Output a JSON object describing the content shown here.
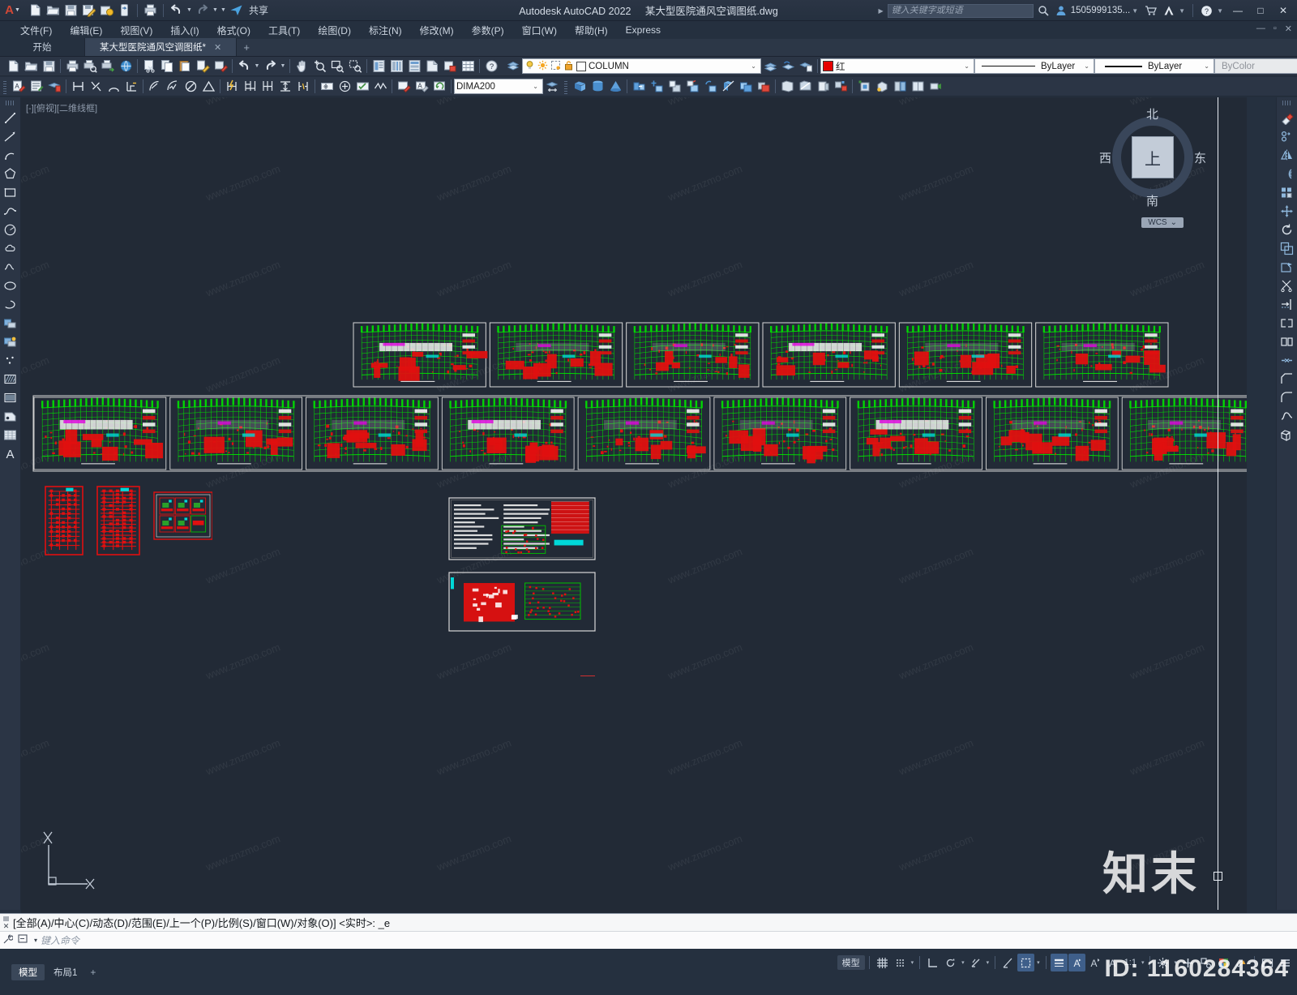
{
  "window": {
    "app_title": "Autodesk AutoCAD 2022",
    "file_name": "某大型医院通风空调图纸.dwg",
    "share_label": "共享",
    "search_placeholder": "键入关键字或短语",
    "user_account": "1505999135...",
    "minimize": "—",
    "maximize": "□",
    "close": "✕"
  },
  "menubar": {
    "items": [
      {
        "label": "文件(F)",
        "name": "menu-file"
      },
      {
        "label": "编辑(E)",
        "name": "menu-edit"
      },
      {
        "label": "视图(V)",
        "name": "menu-view"
      },
      {
        "label": "插入(I)",
        "name": "menu-insert"
      },
      {
        "label": "格式(O)",
        "name": "menu-format"
      },
      {
        "label": "工具(T)",
        "name": "menu-tools"
      },
      {
        "label": "绘图(D)",
        "name": "menu-draw"
      },
      {
        "label": "标注(N)",
        "name": "menu-dimension"
      },
      {
        "label": "修改(M)",
        "name": "menu-modify"
      },
      {
        "label": "参数(P)",
        "name": "menu-parametric"
      },
      {
        "label": "窗口(W)",
        "name": "menu-window"
      },
      {
        "label": "帮助(H)",
        "name": "menu-help"
      },
      {
        "label": "Express",
        "name": "menu-express"
      }
    ],
    "win_minimize": "—",
    "win_restore": "▫",
    "win_close": "✕"
  },
  "doctabs": {
    "start_label": "开始",
    "active_label": "某大型医院通风空调图纸*",
    "close_glyph": "✕",
    "new_tab_glyph": "+"
  },
  "properties": {
    "layer_name": "COLUMN",
    "color_name": "红",
    "color_hex": "#e60000",
    "linetype": "ByLayer",
    "lineweight": "ByLayer",
    "plotstyle": "ByColor",
    "dimstyle": "DIMA200",
    "dropdown_glyph": "⌄"
  },
  "viewport": {
    "label": "[-][俯视][二维线框]",
    "viewcube": {
      "north": "北",
      "south": "南",
      "west": "西",
      "east": "东",
      "top": "上",
      "wcs": "WCS",
      "wcs_caret": "⌄"
    },
    "ucs_x": "X",
    "ucs_y": "Y"
  },
  "left_toolbar": {
    "tools": [
      {
        "name": "line-icon",
        "title": "直线"
      },
      {
        "name": "polyline-icon",
        "title": "多段线"
      },
      {
        "name": "arc-icon",
        "title": "圆弧"
      },
      {
        "name": "polygon-icon",
        "title": "多边形"
      },
      {
        "name": "rectangle-icon",
        "title": "矩形"
      },
      {
        "name": "spline-icon",
        "title": "样条曲线"
      },
      {
        "name": "circle-icon",
        "title": "圆"
      },
      {
        "name": "revision-cloud-icon",
        "title": "修订云线"
      },
      {
        "name": "wave-line-icon",
        "title": "波浪线"
      },
      {
        "name": "ellipse-icon",
        "title": "椭圆"
      },
      {
        "name": "elliptical-arc-icon",
        "title": "椭圆弧"
      },
      {
        "name": "insert-block-icon",
        "title": "插入块"
      },
      {
        "name": "create-block-icon",
        "title": "创建块"
      },
      {
        "name": "point-icon",
        "title": "点"
      },
      {
        "name": "hatch-icon",
        "title": "图案填充"
      },
      {
        "name": "gradient-icon",
        "title": "渐变色"
      },
      {
        "name": "region-icon",
        "title": "面域"
      },
      {
        "name": "table-icon",
        "title": "表格"
      },
      {
        "name": "text-icon",
        "title": "多行文字"
      }
    ]
  },
  "right_toolbar": {
    "tools": [
      {
        "name": "erase-icon",
        "title": "删除"
      },
      {
        "name": "copy-icon",
        "title": "复制"
      },
      {
        "name": "mirror-icon",
        "title": "镜像"
      },
      {
        "name": "offset-icon",
        "title": "偏移"
      },
      {
        "name": "array-icon",
        "title": "阵列"
      },
      {
        "name": "move-icon",
        "title": "移动"
      },
      {
        "name": "rotate-icon",
        "title": "旋转"
      },
      {
        "name": "scale-icon",
        "title": "缩放"
      },
      {
        "name": "stretch-icon",
        "title": "拉伸"
      },
      {
        "name": "trim-icon",
        "title": "修剪"
      },
      {
        "name": "extend-icon",
        "title": "延伸"
      },
      {
        "name": "break-icon",
        "title": "打断"
      },
      {
        "name": "break-at-point-icon",
        "title": "打断于点"
      },
      {
        "name": "join-icon",
        "title": "合并"
      },
      {
        "name": "chamfer-icon",
        "title": "倒角"
      },
      {
        "name": "fillet-icon",
        "title": "圆角"
      },
      {
        "name": "blend-curves-icon",
        "title": "光顺曲线"
      },
      {
        "name": "explode-icon",
        "title": "分解"
      }
    ]
  },
  "command_line": {
    "history": "[全部(A)/中心(C)/动态(D)/范围(E)/上一个(P)/比例(S)/窗口(W)/对象(O)] <实时>: _e",
    "prompt_placeholder": "键入命令",
    "close_glyph": "✕",
    "caret_glyph": "▾"
  },
  "statusbar": {
    "layout_tabs": [
      {
        "label": "模型",
        "active": true
      },
      {
        "label": "布局1",
        "active": false
      }
    ],
    "add_layout_glyph": "+",
    "model_label": "模型",
    "scale": "1:1",
    "caret": "▾",
    "items": [
      {
        "name": "grid-display-toggle",
        "title": "栅格"
      },
      {
        "name": "snap-mode-toggle",
        "title": "捕捉模式"
      },
      {
        "name": "ortho-mode-toggle",
        "title": "正交"
      },
      {
        "name": "polar-tracking-toggle",
        "title": "极轴追踪"
      },
      {
        "name": "object-snap-toggle",
        "title": "对象捕捉"
      },
      {
        "name": "object-snap-tracking-toggle",
        "title": "对象捕捉追踪"
      },
      {
        "name": "lineweight-toggle",
        "title": "线宽"
      },
      {
        "name": "transparency-toggle",
        "title": "透明度"
      },
      {
        "name": "selection-cycling-toggle",
        "title": "选择循环"
      },
      {
        "name": "annotation-visibility-toggle",
        "title": "注释可见性"
      },
      {
        "name": "auto-scale-toggle",
        "title": "自动添加比例"
      },
      {
        "name": "annotation-scale",
        "title": "注释比例"
      },
      {
        "name": "workspace-switch-icon",
        "title": "切换工作空间"
      },
      {
        "name": "hardware-accel-icon",
        "title": "图形性能"
      },
      {
        "name": "isolate-objects-icon",
        "title": "隔离对象"
      },
      {
        "name": "clean-screen-icon",
        "title": "全屏显示"
      },
      {
        "name": "customization-icon",
        "title": "自定义"
      }
    ]
  },
  "watermark": {
    "brand": "知末",
    "id_text": "ID: 1160284364",
    "tiles": "www.znzmo.com"
  },
  "drawing": {
    "title_blocks_row1_count": 6,
    "title_blocks_row2_count": 9,
    "detail_blocks": 3,
    "schedule_blocks": 2,
    "palette": {
      "structure_green": "#00e000",
      "equipment_red": "#e01010",
      "duct_cyan": "#00d8d8",
      "text_white": "#f0f0f0",
      "magenta": "#e000e0",
      "yellow": "#e0e000",
      "frame": "#d8d8d8"
    }
  }
}
